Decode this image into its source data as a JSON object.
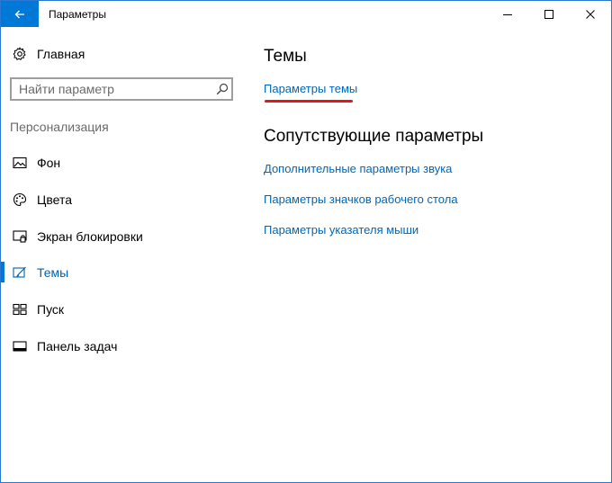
{
  "window": {
    "title": "Параметры"
  },
  "sidebar": {
    "home_label": "Главная",
    "search_placeholder": "Найти параметр",
    "section_label": "Персонализация",
    "items": [
      {
        "label": "Фон",
        "icon": "picture-icon"
      },
      {
        "label": "Цвета",
        "icon": "palette-icon"
      },
      {
        "label": "Экран блокировки",
        "icon": "lock-screen-icon"
      },
      {
        "label": "Темы",
        "icon": "themes-icon",
        "active": true
      },
      {
        "label": "Пуск",
        "icon": "start-icon"
      },
      {
        "label": "Панель задач",
        "icon": "taskbar-icon"
      }
    ]
  },
  "main": {
    "title": "Темы",
    "theme_settings_link": "Параметры темы",
    "related_title": "Сопутствующие параметры",
    "related_links": [
      "Дополнительные параметры звука",
      "Параметры значков рабочего стола",
      "Параметры указателя мыши"
    ]
  },
  "colors": {
    "accent": "#0078d7",
    "link": "#0067b8",
    "highlight_underline": "#e0181b"
  }
}
